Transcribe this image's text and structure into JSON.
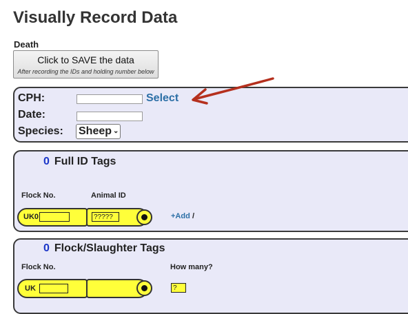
{
  "page": {
    "title": "Visually Record Data",
    "section": "Death"
  },
  "save_button": {
    "label": "Click to SAVE the data",
    "hint": "After recording the IDs and holding number below"
  },
  "cph_panel": {
    "cph_label": "CPH:",
    "cph_value": "",
    "select_link": "Select",
    "date_label": "Date:",
    "date_value": "",
    "species_label": "Species:",
    "species_value": "Sheep"
  },
  "full_id": {
    "count": "0",
    "heading": "Full ID Tags",
    "flock_label": "Flock No.",
    "animal_label": "Animal ID",
    "prefix": "UK0",
    "flock_value": "",
    "animal_value": "?????",
    "add_link": "+Add",
    "separator": "/"
  },
  "flock_tags": {
    "count": "0",
    "heading": "Flock/Slaughter Tags",
    "flock_label": "Flock No.",
    "howmany_label": "How many?",
    "prefix": "UK",
    "flock_value": "",
    "howmany_value": "?"
  },
  "colors": {
    "panel_bg": "#e9e9f8",
    "tag_yellow": "#ffff3a",
    "link_blue": "#2c6fa6",
    "count_blue": "#1a35c8",
    "arrow_red": "#b5301e"
  },
  "icons": {
    "arrow": "red-arrow-icon",
    "stud": "tag-stud-icon",
    "chevron": "chevron-down-icon"
  }
}
